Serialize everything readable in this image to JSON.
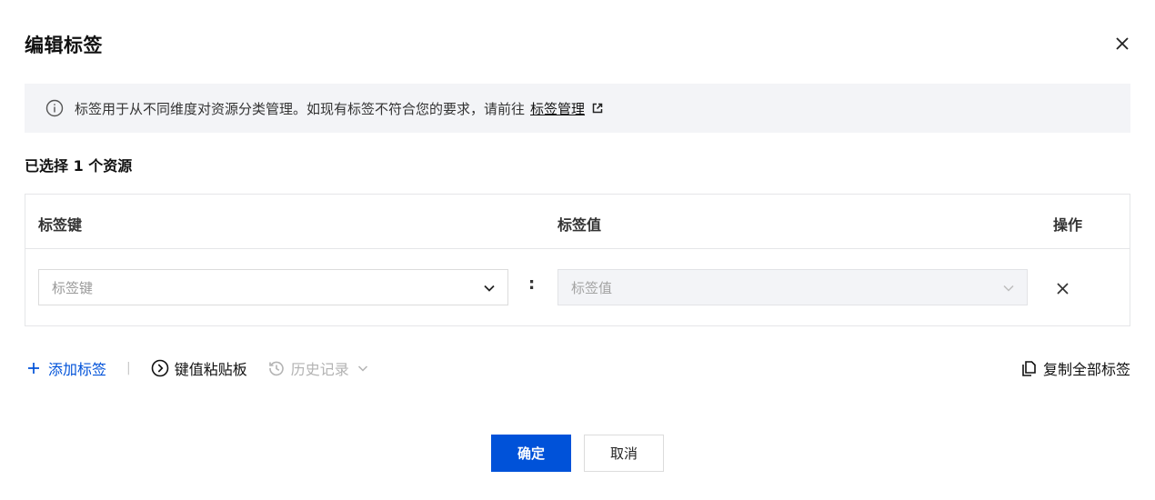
{
  "dialog": {
    "title": "编辑标签"
  },
  "notice": {
    "text": "标签用于从不同维度对资源分类管理。如现有标签不符合您的要求，请前往",
    "link_label": "标签管理"
  },
  "selection": {
    "summary": "已选择 1 个资源"
  },
  "table": {
    "headers": {
      "key": "标签键",
      "value": "标签值",
      "action": "操作"
    },
    "rows": [
      {
        "key_placeholder": "标签键",
        "value_placeholder": "标签值",
        "separator": ":"
      }
    ]
  },
  "actions": {
    "add_tag": "添加标签",
    "divider": "|",
    "paste_board": "键值粘贴板",
    "history": "历史记录",
    "copy_all": "复制全部标签"
  },
  "footer": {
    "confirm": "确定",
    "cancel": "取消"
  },
  "colors": {
    "primary": "#0052d9",
    "notice_bg": "#f3f4f7",
    "border": "#e5e6e8"
  }
}
